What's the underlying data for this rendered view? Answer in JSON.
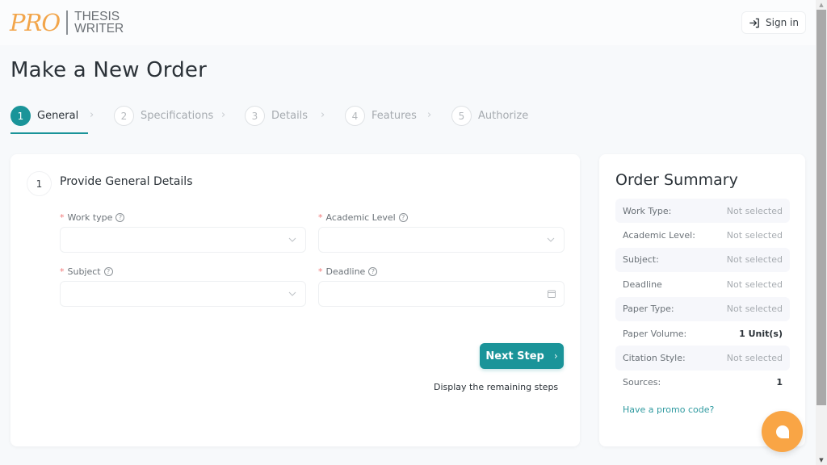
{
  "header": {
    "logo": {
      "pro": "PRO",
      "line1": "THESIS",
      "line2": "WRITER"
    },
    "signin_label": "Sign in"
  },
  "page_title": "Make a New Order",
  "steps": [
    {
      "num": "1",
      "label": "General",
      "active": true
    },
    {
      "num": "2",
      "label": "Specifications",
      "active": false
    },
    {
      "num": "3",
      "label": "Details",
      "active": false
    },
    {
      "num": "4",
      "label": "Features",
      "active": false
    },
    {
      "num": "5",
      "label": "Authorize",
      "active": false
    }
  ],
  "step_separator": "›",
  "form": {
    "section_num": "1",
    "section_title": "Provide General Details",
    "required_mark": "*",
    "help_glyph": "?",
    "fields": {
      "work_type": {
        "label": "Work type",
        "value": "",
        "icon": "chevron-down-icon"
      },
      "academic_level": {
        "label": "Academic Level",
        "value": "",
        "icon": "chevron-down-icon"
      },
      "subject": {
        "label": "Subject",
        "value": "",
        "icon": "chevron-down-icon"
      },
      "deadline": {
        "label": "Deadline",
        "value": "",
        "icon": "calendar-icon"
      }
    },
    "next_button": "Next Step",
    "next_chevron": "›",
    "remaining_steps_link": "Display the remaining steps"
  },
  "summary": {
    "title": "Order Summary",
    "rows": [
      {
        "key": "Work Type:",
        "value": "Not selected",
        "set": false
      },
      {
        "key": "Academic Level:",
        "value": "Not selected",
        "set": false
      },
      {
        "key": "Subject:",
        "value": "Not selected",
        "set": false
      },
      {
        "key": "Deadline",
        "value": "Not selected",
        "set": false
      },
      {
        "key": "Paper Type:",
        "value": "Not selected",
        "set": false
      },
      {
        "key": "Paper Volume:",
        "value": "1 Unit(s)",
        "set": true
      },
      {
        "key": "Citation Style:",
        "value": "Not selected",
        "set": false
      },
      {
        "key": "Sources:",
        "value": "1",
        "set": true
      }
    ],
    "promo_link": "Have a promo code?"
  },
  "colors": {
    "accent": "#1a9499",
    "logo_orange": "#f2a54a",
    "chat_orange": "#f9a545",
    "required_red": "#f07a7a",
    "link_teal": "#2f9aa0"
  },
  "scrollbar": {
    "up": "▲",
    "down": "▼"
  }
}
